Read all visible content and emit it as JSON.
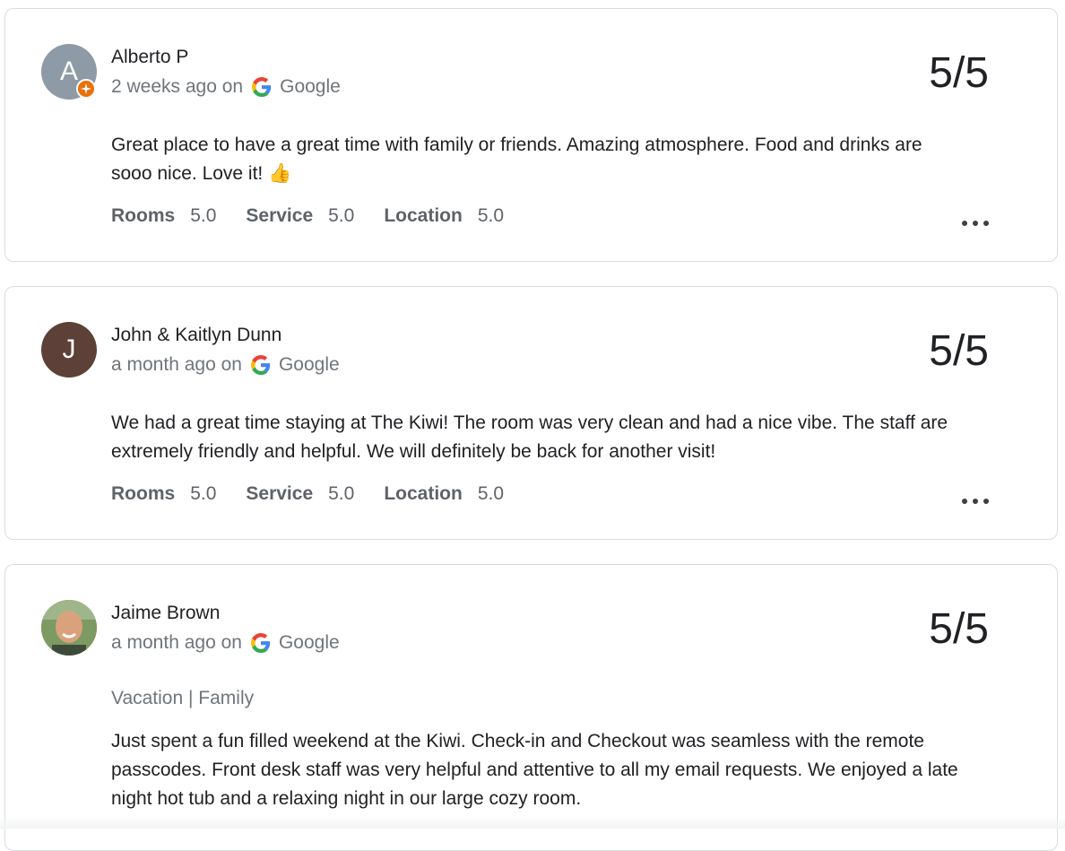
{
  "reviews": [
    {
      "initial": "A",
      "name": "Alberto P",
      "time": "2 weeks ago on",
      "source": "Google",
      "score": "5/5",
      "text": "Great place to have a great time with family or friends. Amazing atmosphere. Food and drinks are sooo nice. Love it! 👍",
      "ratings": [
        {
          "label": "Rooms",
          "value": "5.0"
        },
        {
          "label": "Service",
          "value": "5.0"
        },
        {
          "label": "Location",
          "value": "5.0"
        }
      ],
      "avatar_color": "#8e9ba6",
      "local_guide_badge": true
    },
    {
      "initial": "J",
      "name": "John & Kaitlyn Dunn",
      "time": "a month ago on",
      "source": "Google",
      "score": "5/5",
      "text": "We had a great time staying at The Kiwi! The room was very clean and had a nice vibe. The staff are extremely friendly and helpful. We will definitely be back for another visit!",
      "ratings": [
        {
          "label": "Rooms",
          "value": "5.0"
        },
        {
          "label": "Service",
          "value": "5.0"
        },
        {
          "label": "Location",
          "value": "5.0"
        }
      ],
      "avatar_color": "#5d4037"
    },
    {
      "name": "Jaime Brown",
      "time": "a month ago on",
      "source": "Google",
      "score": "5/5",
      "trip_tags": "Vacation | Family",
      "text": "Just spent a fun filled weekend at the Kiwi. Check-in and Checkout was seamless with the remote passcodes. Front desk staff was very helpful and attentive to all my email requests. We enjoyed a late night hot tub and a relaxing night in our large cozy room.",
      "avatar": "profile-photo"
    }
  ],
  "icons": {
    "source_logo": "google-g-icon",
    "more_menu": "more-horizontal-icon",
    "badge": "local-guide-badge-icon"
  }
}
